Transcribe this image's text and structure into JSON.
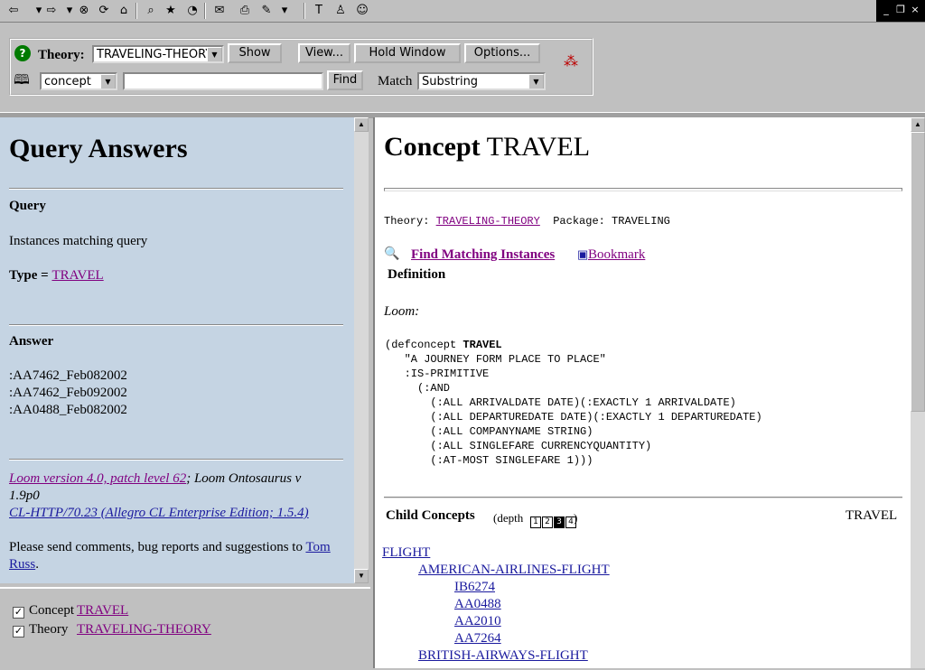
{
  "toolbar": {
    "buttons": [
      {
        "name": "back-icon",
        "glyph": "⇦"
      },
      {
        "name": "back-dropdown-icon",
        "glyph": "▾"
      },
      {
        "name": "forward-icon",
        "glyph": "⇨"
      },
      {
        "name": "forward-dropdown-icon",
        "glyph": "▾"
      },
      {
        "name": "stop-icon",
        "glyph": "⊗"
      },
      {
        "name": "refresh-icon",
        "glyph": "⟳"
      },
      {
        "name": "home-icon",
        "glyph": "⌂"
      },
      {
        "name": "search-icon",
        "glyph": "⌕"
      },
      {
        "name": "favorites-icon",
        "glyph": "★"
      },
      {
        "name": "history-icon",
        "glyph": "◔"
      },
      {
        "name": "mail-icon",
        "glyph": "✉"
      },
      {
        "name": "print-icon",
        "glyph": "⎙"
      },
      {
        "name": "edit-icon",
        "glyph": "✎"
      },
      {
        "name": "discuss-icon",
        "glyph": "▾"
      },
      {
        "name": "text-icon",
        "glyph": "T"
      },
      {
        "name": "messenger-icon",
        "glyph": "♙"
      },
      {
        "name": "user-icon",
        "glyph": "☺"
      }
    ],
    "window_controls": {
      "minimize": "_",
      "restore": "❐",
      "close": "×"
    }
  },
  "panel": {
    "theory_label": "Theory:",
    "theory_value": "TRAVELING-THEORY",
    "show_label": "Show",
    "view_label": "View...",
    "hold_window_label": "Hold Window",
    "options_label": "Options...",
    "type_value": "concept",
    "search_value": "",
    "find_label": "Find",
    "match_label": "Match",
    "match_value": "Substring"
  },
  "left": {
    "title": "Query Answers",
    "query_heading": "Query",
    "query_desc": "Instances matching query",
    "type_label": "Type = ",
    "type_link": "TRAVEL",
    "answer_heading": "Answer",
    "answers": [
      ":AA7462_Feb082002",
      ":AA7462_Feb092002",
      ":AA0488_Feb082002"
    ],
    "footer_loom_link": "Loom version 4.0, patch level 62",
    "footer_loom_rest": "; Loom Ontosaurus v 1.9p0",
    "footer_http_link": "CL-HTTP/70.23 (Allegro CL Enterprise Edition; 1.5.4)",
    "footer_comments": "Please send comments, bug reports and suggestions to ",
    "footer_person_link": "Tom Russ",
    "footer_period": "."
  },
  "bottom_left": {
    "concept_label": "Concept",
    "concept_link": "TRAVEL",
    "theory_label": "Theory",
    "theory_link": "TRAVELING-THEORY"
  },
  "right": {
    "title_prefix": "Concept",
    "title_name": "TRAVEL",
    "theory_label": "Theory: ",
    "theory_link": "TRAVELING-THEORY",
    "package_label": "  Package: TRAVELING",
    "find_instances_link": "Find Matching Instances",
    "bookmark_link": " Bookmark",
    "definition_heading": "Definition",
    "loom_label": "Loom:",
    "code_lines": [
      {
        "indent": 0,
        "text": "(defconcept ",
        "bold": "TRAVEL"
      },
      {
        "indent": 3,
        "text": "\"A JOURNEY FORM PLACE TO PLACE\"",
        "bold": ""
      },
      {
        "indent": 3,
        "text": ":IS-PRIMITIVE",
        "bold": ""
      },
      {
        "indent": 5,
        "text": "(:AND",
        "bold": ""
      },
      {
        "indent": 7,
        "text": "(:ALL ARRIVALDATE DATE)(:EXACTLY 1 ARRIVALDATE)",
        "bold": ""
      },
      {
        "indent": 7,
        "text": "(:ALL DEPARTUREDATE DATE)(:EXACTLY 1 DEPARTUREDATE)",
        "bold": ""
      },
      {
        "indent": 7,
        "text": "(:ALL COMPANYNAME STRING)",
        "bold": ""
      },
      {
        "indent": 7,
        "text": "(:ALL SINGLEFARE CURRENCYQUANTITY)",
        "bold": ""
      },
      {
        "indent": 7,
        "text": "(:AT-MOST SINGLEFARE 1)))",
        "bold": ""
      }
    ],
    "child_heading": "Child Concepts",
    "depth_label": "(depth ",
    "depth_values": [
      "1",
      "2",
      "3",
      "4"
    ],
    "depth_close": ")",
    "child_right_label": "TRAVEL",
    "children": [
      {
        "level": 0,
        "name": "FLIGHT"
      },
      {
        "level": 1,
        "name": "AMERICAN-AIRLINES-FLIGHT"
      },
      {
        "level": 2,
        "name": "IB6274"
      },
      {
        "level": 2,
        "name": "AA0488"
      },
      {
        "level": 2,
        "name": "AA2010"
      },
      {
        "level": 2,
        "name": "AA7264"
      },
      {
        "level": 1,
        "name": "BRITISH-AIRWAYS-FLIGHT"
      }
    ]
  }
}
